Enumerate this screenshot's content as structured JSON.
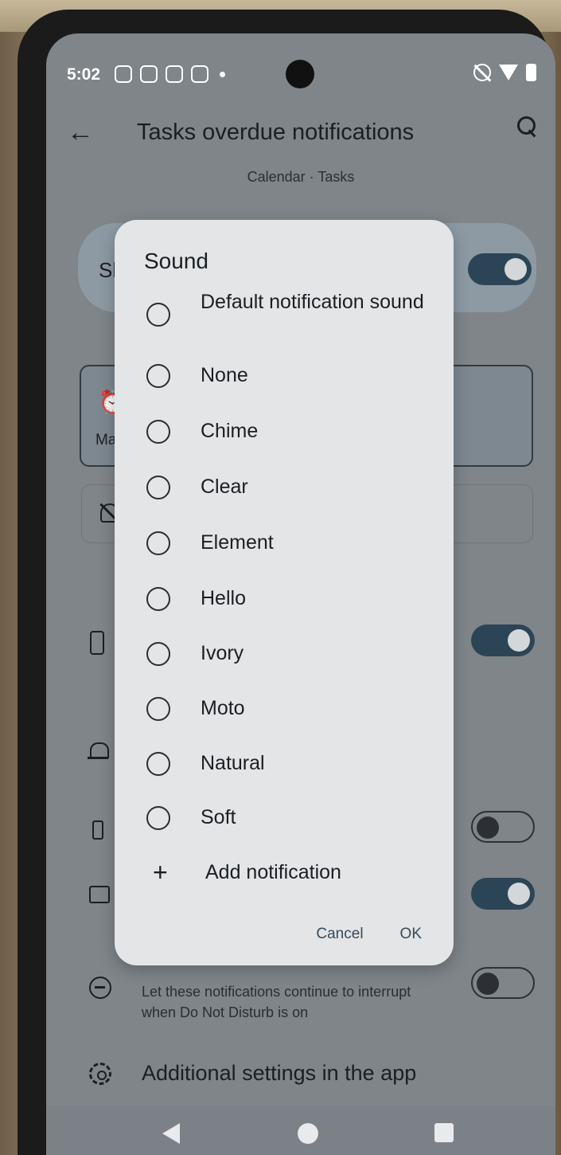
{
  "status_bar": {
    "time": "5:02",
    "notification_icons": [
      "messenger-icon",
      "sim-icon",
      "bag-icon",
      "chat-icon"
    ],
    "system_icons": [
      "mute-icon",
      "wifi-icon",
      "battery-icon"
    ]
  },
  "app_bar": {
    "title": "Tasks overdue notifications",
    "back_icon": "arrow-left-icon",
    "search_icon": "search-icon"
  },
  "subtitle": "Calendar · Tasks",
  "background": {
    "show_label_partial": "Sh",
    "alert_label_partial": "May",
    "toggles": [
      true,
      true,
      false,
      true,
      false
    ],
    "dnd_description": "Let these notifications continue to interrupt when Do Not Disturb is on",
    "additional_settings": "Additional settings in the app"
  },
  "dialog": {
    "title": "Sound",
    "options": [
      "Default notification sound",
      "None",
      "Chime",
      "Clear",
      "Element",
      "Hello",
      "Ivory",
      "Moto",
      "Natural",
      "Soft"
    ],
    "add_label": "Add notification",
    "cancel_label": "Cancel",
    "ok_label": "OK"
  },
  "nav_bar": {
    "buttons": [
      "back-triangle-icon",
      "home-circle-icon",
      "recents-square-icon"
    ]
  }
}
